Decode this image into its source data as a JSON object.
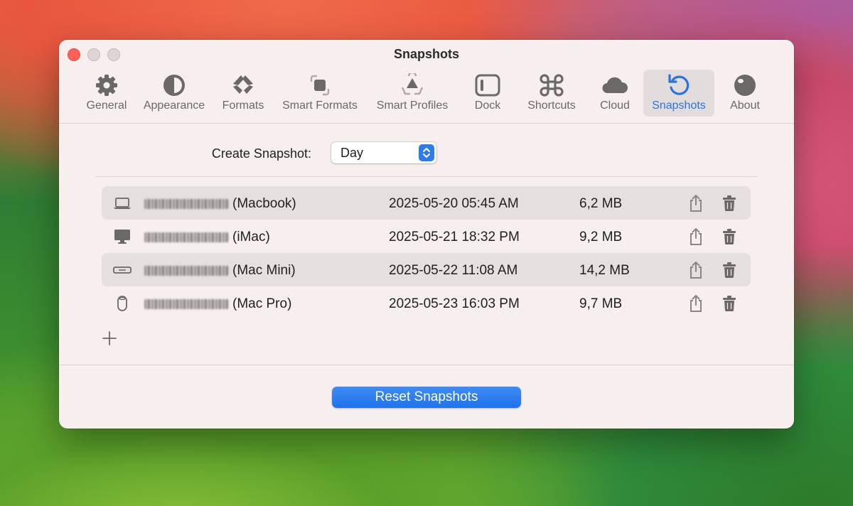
{
  "window": {
    "title": "Snapshots"
  },
  "toolbar": {
    "tabs": [
      {
        "label": "General",
        "icon": "gear-icon"
      },
      {
        "label": "Appearance",
        "icon": "half-circle-icon"
      },
      {
        "label": "Formats",
        "icon": "formats-icon"
      },
      {
        "label": "Smart Formats",
        "icon": "smart-formats-icon"
      },
      {
        "label": "Smart Profiles",
        "icon": "smart-profiles-icon"
      },
      {
        "label": "Dock",
        "icon": "dock-icon"
      },
      {
        "label": "Shortcuts",
        "icon": "command-icon"
      },
      {
        "label": "Cloud",
        "icon": "cloud-icon"
      },
      {
        "label": "Snapshots",
        "icon": "restore-icon",
        "active": true
      },
      {
        "label": "About",
        "icon": "sphere-icon"
      }
    ]
  },
  "create_snapshot": {
    "label": "Create Snapshot:",
    "value": "Day"
  },
  "snapshots": [
    {
      "device": "laptop-icon",
      "name_suffix": "(Macbook)",
      "date": "2025-05-20 05:45 AM",
      "size": "6,2 MB"
    },
    {
      "device": "imac-icon",
      "name_suffix": "(iMac)",
      "date": "2025-05-21 18:32 PM",
      "size": "9,2 MB"
    },
    {
      "device": "mac-mini-icon",
      "name_suffix": "(Mac Mini)",
      "date": "2025-05-22 11:08 AM",
      "size": "14,2 MB"
    },
    {
      "device": "mac-pro-icon",
      "name_suffix": "(Mac Pro)",
      "date": "2025-05-23 16:03 PM",
      "size": "9,7 MB"
    }
  ],
  "footer": {
    "reset_label": "Reset Snapshots"
  },
  "colors": {
    "accent": "#2c7cf0",
    "window_bg": "#f6efee",
    "close": "#ff5f57"
  }
}
